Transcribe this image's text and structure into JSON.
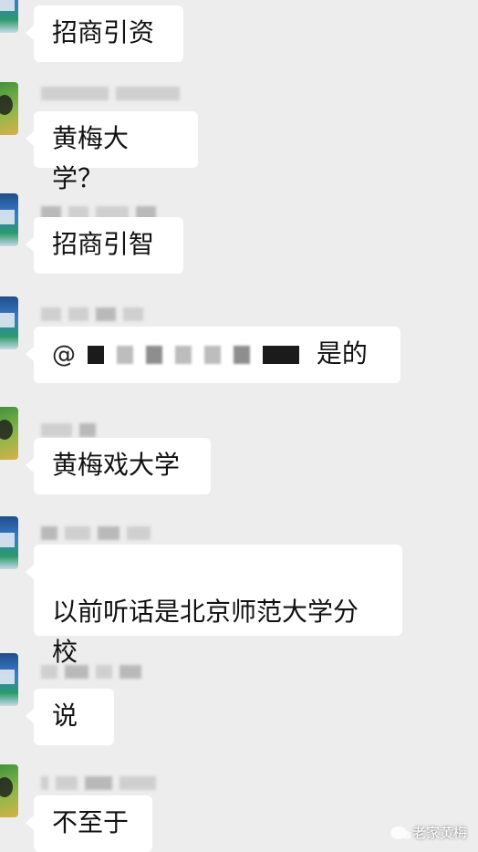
{
  "messages": [
    {
      "text": "招商引资"
    },
    {
      "text": "黄梅大学？"
    },
    {
      "text": "招商引智"
    },
    {
      "mention": "@",
      "text": "是的"
    },
    {
      "text": "黄梅戏大学"
    },
    {
      "text": "以前听话是北京师范大学分\n校"
    },
    {
      "text": "说"
    },
    {
      "text": "不至于"
    }
  ],
  "watermark": {
    "label": "老家黄梅",
    "icon": "wechat-icon"
  },
  "colors": {
    "background": "#ededed",
    "bubble": "#ffffff"
  }
}
